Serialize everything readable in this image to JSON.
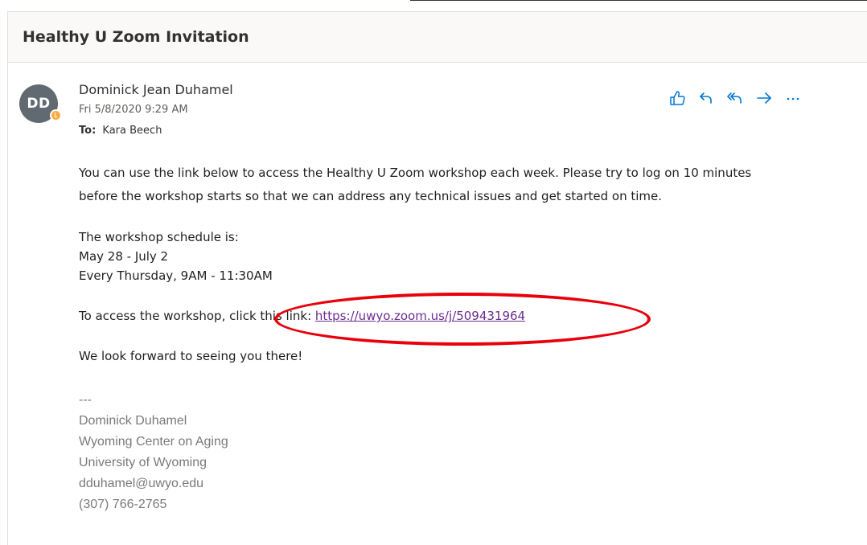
{
  "email": {
    "subject": "Healthy U Zoom Invitation",
    "sender": {
      "initials": "DD",
      "name": "Dominick Jean Duhamel"
    },
    "date": "Fri 5/8/2020 9:29 AM",
    "to_label": "To:",
    "to_value": "Kara Beech",
    "actions": [
      {
        "icon": "thumbs-up-icon"
      },
      {
        "icon": "reply-icon"
      },
      {
        "icon": "reply-all-icon"
      },
      {
        "icon": "forward-icon"
      },
      {
        "icon": "more-icon"
      }
    ],
    "body": {
      "para1_line1": "You can use the link below to access the Healthy U Zoom workshop each week. Please try to log on 10 minutes",
      "para1_line2": "before the workshop starts so that we can address any technical issues and get started on time.",
      "schedule_heading": "The workshop schedule is:",
      "schedule_dates": "May 28 - July 2",
      "schedule_time": "Every Thursday, 9AM - 11:30AM",
      "link_prefix": "To access the workshop, click this link: ",
      "link_text": "https://uwyo.zoom.us/j/509431964",
      "closing": "We look forward to seeing you there!"
    },
    "signature": {
      "separator": "---",
      "name": "Dominick Duhamel",
      "org": "Wyoming Center on Aging",
      "university": "University of Wyoming",
      "email": "dduhamel@uwyo.edu",
      "phone": "(307) 766-2765"
    }
  },
  "colors": {
    "accent": "#0078d4",
    "link": "#6b2c8f",
    "annotation": "#e8000b",
    "avatar": "#616a70",
    "presence": "#ffaa44"
  }
}
